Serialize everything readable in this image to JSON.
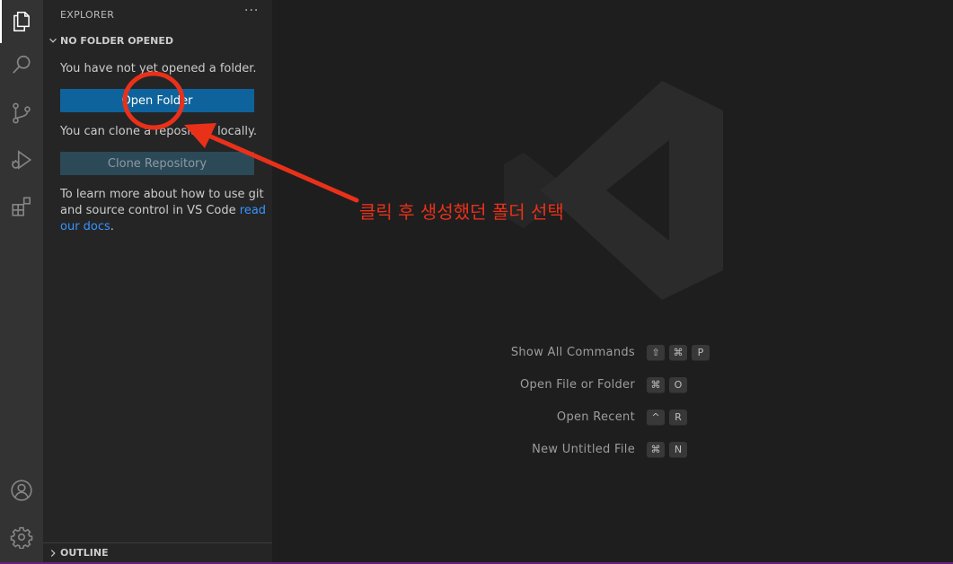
{
  "sidebar": {
    "header": "EXPLORER",
    "more": "···",
    "section_title": "NO FOLDER OPENED",
    "no_folder_text": "You have not yet opened a folder.",
    "open_folder_label": "Open Folder",
    "clone_text": "You can clone a repository locally.",
    "clone_label": "Clone Repository",
    "learn_line1": "To learn more about how to use git",
    "learn_line2_prefix": "and source control in VS Code ",
    "learn_link_part1": "read",
    "learn_link_part2": "our docs",
    "learn_suffix": ".",
    "outline_title": "OUTLINE"
  },
  "activity_bar": {
    "icons": [
      "explorer-icon",
      "search-icon",
      "source-control-icon",
      "run-debug-icon",
      "extensions-icon",
      "account-icon",
      "settings-gear-icon"
    ]
  },
  "shortcuts": [
    {
      "label": "Show All Commands",
      "keys": [
        "⇧",
        "⌘",
        "P"
      ]
    },
    {
      "label": "Open File or Folder",
      "keys": [
        "⌘",
        "O"
      ]
    },
    {
      "label": "Open Recent",
      "keys": [
        "^",
        "R"
      ]
    },
    {
      "label": "New Untitled File",
      "keys": [
        "⌘",
        "N"
      ]
    }
  ],
  "annotation": {
    "text": "클릭 후 생성했던 폴더 선택",
    "color": "#e9311a"
  },
  "colors": {
    "activity_bar": "#333333",
    "sidebar": "#252526",
    "editor": "#1e1e1e",
    "primary_button": "#0e639c",
    "link": "#3794ff",
    "status_accent": "#68217a"
  }
}
